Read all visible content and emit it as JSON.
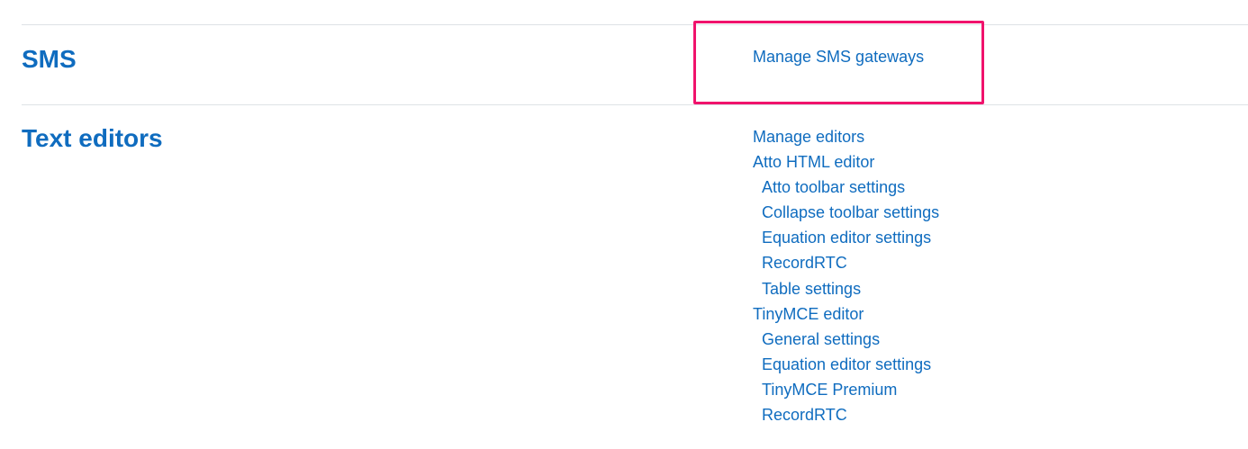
{
  "sections": [
    {
      "title": "SMS",
      "links": [
        {
          "label": "Manage SMS gateways",
          "sub": false
        }
      ]
    },
    {
      "title": "Text editors",
      "links": [
        {
          "label": "Manage editors",
          "sub": false
        },
        {
          "label": "Atto HTML editor",
          "sub": false
        },
        {
          "label": "Atto toolbar settings",
          "sub": true
        },
        {
          "label": "Collapse toolbar settings",
          "sub": true
        },
        {
          "label": "Equation editor settings",
          "sub": true
        },
        {
          "label": "RecordRTC",
          "sub": true
        },
        {
          "label": "Table settings",
          "sub": true
        },
        {
          "label": "TinyMCE editor",
          "sub": false
        },
        {
          "label": "General settings",
          "sub": true
        },
        {
          "label": "Equation editor settings",
          "sub": true
        },
        {
          "label": "TinyMCE Premium",
          "sub": true
        },
        {
          "label": "RecordRTC",
          "sub": true
        }
      ]
    }
  ],
  "colors": {
    "link": "#0f6cbf",
    "divider": "#dee2e6",
    "highlight": "#f0136c"
  }
}
